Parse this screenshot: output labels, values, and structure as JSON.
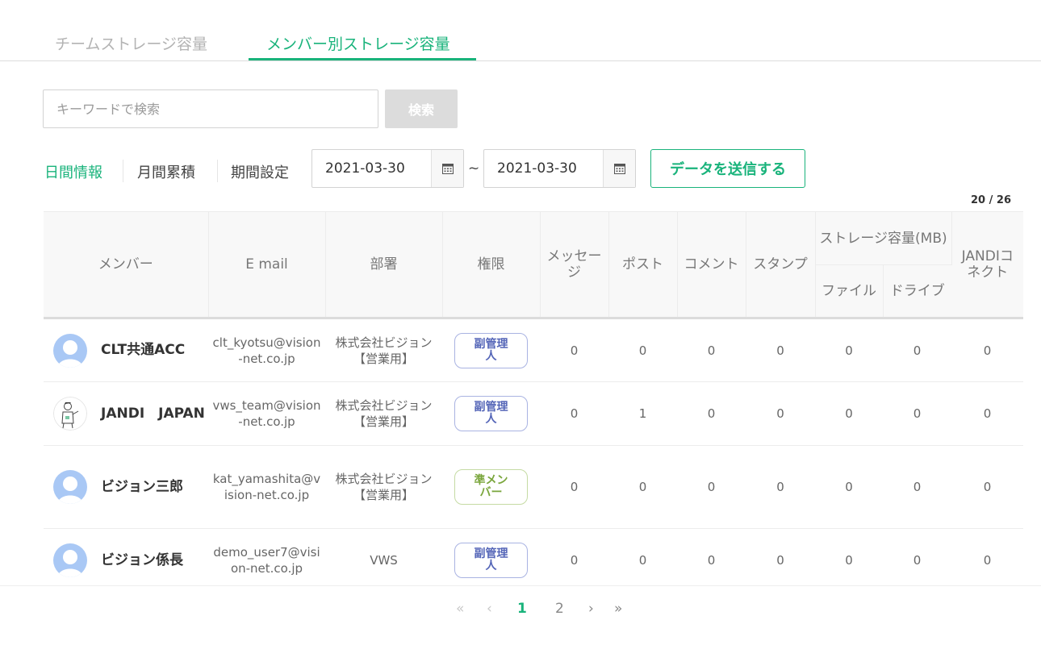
{
  "tabs": [
    {
      "label": "チームストレージ容量"
    },
    {
      "label": "メンバー別ストレージ容量"
    }
  ],
  "search": {
    "placeholder": "キーワードで検索",
    "button": "検索"
  },
  "period": {
    "daily": "日間情報",
    "monthly": "月間累積",
    "custom": "期間設定",
    "start_date": "2021-03-30",
    "separator": "~",
    "end_date": "2021-03-30",
    "send_button": "データを送信する"
  },
  "count": "20 / 26",
  "table": {
    "headers": {
      "member": "メンバー",
      "email": "E mail",
      "dept": "部署",
      "role": "権限",
      "message": "メッセージ",
      "post": "ポスト",
      "comment": "コメント",
      "stamp": "スタンプ",
      "storage": "ストレージ容量(MB)",
      "file": "ファイル",
      "drive": "ドライブ",
      "connect": "JANDIコネクト"
    },
    "rows": [
      {
        "name": "CLT共通ACC",
        "email": "clt_kyotsu@vision-net.co.jp",
        "dept": "株式会社ビジョン【営業用】",
        "role": "副管理人",
        "role_type": "sub",
        "message": "0",
        "post": "0",
        "comment": "0",
        "stamp": "0",
        "file": "0",
        "drive": "0",
        "connect": "0"
      },
      {
        "name": "JANDI　JAPAN",
        "email": "vws_team@vision-net.co.jp",
        "dept": "株式会社ビジョン【営業用】",
        "role": "副管理人",
        "role_type": "sub",
        "message": "0",
        "post": "1",
        "comment": "0",
        "stamp": "0",
        "file": "0",
        "drive": "0",
        "connect": "0"
      },
      {
        "name": "ビジョン三郎",
        "email": "kat_yamashita@vision-net.co.jp",
        "dept": "株式会社ビジョン【営業用】",
        "role": "準メンバー",
        "role_type": "assoc",
        "message": "0",
        "post": "0",
        "comment": "0",
        "stamp": "0",
        "file": "0",
        "drive": "0",
        "connect": "0"
      },
      {
        "name": "ビジョン係長",
        "email": "demo_user7@vision-net.co.jp",
        "dept": "VWS",
        "role": "副管理人",
        "role_type": "sub",
        "message": "0",
        "post": "0",
        "comment": "0",
        "stamp": "0",
        "file": "0",
        "drive": "0",
        "connect": "0"
      }
    ]
  },
  "pagination": {
    "first": "«",
    "prev": "‹",
    "pages": [
      "1",
      "2"
    ],
    "current": "1",
    "next": "›",
    "last": "»"
  },
  "colors": {
    "accent": "#19b37b",
    "sub_badge": "#5566b8",
    "assoc_badge": "#7aa63c"
  }
}
